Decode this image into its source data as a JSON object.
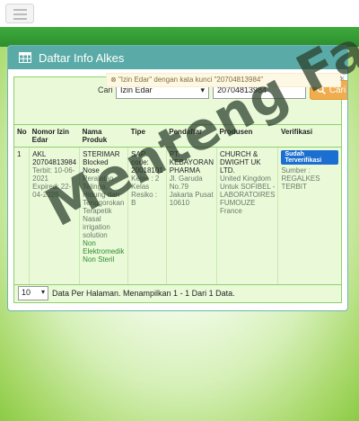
{
  "panel": {
    "title": "Daftar Info Alkes",
    "icon": "table-icon"
  },
  "search": {
    "label": "Cari",
    "field_selected": "Izin Edar",
    "query_value": "20704813984",
    "button_label": "Cari",
    "alert_text": "\"Izin Edar\" dengan kata kunci \"20704813984\""
  },
  "table": {
    "headers": [
      "No",
      "Nomor Izin Edar",
      "Nama Produk",
      "Tipe",
      "Pendaftar",
      "Produsen",
      "Verifikasi"
    ],
    "row": {
      "no": "1",
      "izin": "AKL 20704813984",
      "terbit": "Terbit: 10-06-2021",
      "expired": "Expired: 22-04-2026",
      "produk": "STERIMAR Blocked Nose",
      "produk_desc": "Peralatan Telinga, Hidung dan Tenggorokan Terapetik Nasal irrigation solution",
      "produk_status": "Non Elektromedik Non Steril",
      "tipe_sap": "SAP code: 20018101",
      "tipe_kelas": "Kelas : 2",
      "tipe_resiko": "Kelas Resiko : B",
      "pendaftar": "PT. KEBAYORAN PHARMA",
      "pendaftar_addr": "Jl. Garuda No.79 Jakarta Pusat 10610",
      "produsen": "CHURCH & DWIGHT UK LTD.",
      "produsen_addr": "United Kingdom Untuk SOFIBEL - LABORATOIRES FUMOUZE France",
      "verif_badge": "Sudah Terverifikasi",
      "verif_source": "Sumber : REGALKES TERBIT"
    }
  },
  "footer": {
    "per_page": "10",
    "summary": "Data Per Halaman. Menampilkan 1 - 1 Dari 1 Data."
  },
  "watermark": "Menteng Farma"
}
